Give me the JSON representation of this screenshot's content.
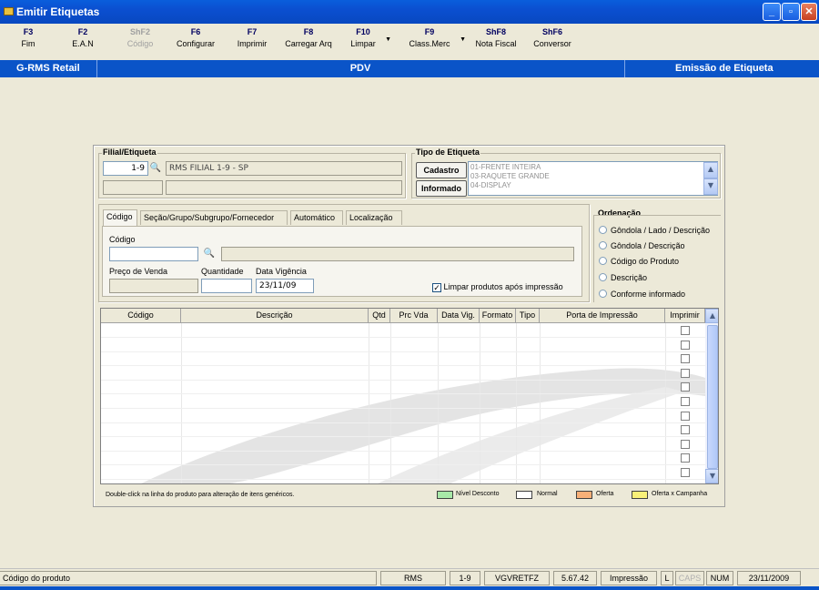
{
  "window": {
    "title": "Emitir Etiquetas"
  },
  "toolbar": [
    {
      "key": "F3",
      "label": "Fim",
      "enabled": true
    },
    {
      "key": "F2",
      "label": "E.A.N",
      "enabled": true
    },
    {
      "key": "ShF2",
      "label": "Código",
      "enabled": false
    },
    {
      "key": "F6",
      "label": "Configurar",
      "enabled": true
    },
    {
      "key": "F7",
      "label": "Imprimir",
      "enabled": true
    },
    {
      "key": "F8",
      "label": "Carregar Arq",
      "enabled": true
    },
    {
      "key": "F10",
      "label": "Limpar",
      "enabled": true
    },
    {
      "key": "F9",
      "label": "Class.Merc",
      "enabled": true
    },
    {
      "key": "ShF8",
      "label": "Nota Fiscal",
      "enabled": true
    },
    {
      "key": "ShF6",
      "label": "Conversor",
      "enabled": true
    }
  ],
  "header": {
    "left": "G-RMS Retail",
    "center": "PDV",
    "right": "Emissão de Etiqueta"
  },
  "filial": {
    "group_label": "Filial/Etiqueta",
    "code": "1-9",
    "name": "RMS FILIAL 1-9 - SP",
    "code2": "",
    "name2": ""
  },
  "tipo": {
    "group_label": "Tipo de Etiqueta",
    "btn_cadastro": "Cadastro",
    "btn_informado": "Informado",
    "options": [
      "01-FRENTE INTEIRA",
      "03-RAQUETE GRANDE",
      "04-DISPLAY"
    ]
  },
  "tabs": [
    "Código",
    "Seção/Grupo/Subgrupo/Fornecedor",
    "Automático",
    "Localização"
  ],
  "form": {
    "codigo_label": "Código",
    "codigo_value": "",
    "descricao_value": "",
    "preco_label": "Preço de Venda",
    "preco_value": "",
    "quantidade_label": "Quantidade",
    "quantidade_value": "",
    "vigencia_label": "Data Vigência",
    "vigencia_value": "23/11/09",
    "limpar_label": "Limpar produtos após impressão",
    "limpar_checked": true
  },
  "ordenacao": {
    "label": "Ordenação",
    "options": [
      "Gôndola / Lado / Descrição",
      "Gôndola / Descrição",
      "Código do Produto",
      "Descrição",
      "Conforme informado"
    ]
  },
  "grid": {
    "columns": [
      "Código",
      "Descrição",
      "Qtd",
      "Prc Vda",
      "Data Vig.",
      "Formato",
      "Tipo",
      "Porta de Impressão",
      "Imprimir"
    ]
  },
  "hint": "Double-click na linha do produto para alteração de itens genéricos.",
  "legend": [
    {
      "label": "Nível Desconto",
      "color": "#A8E8A8"
    },
    {
      "label": "Normal",
      "color": "#FFFFFF"
    },
    {
      "label": "Oferta",
      "color": "#F8B078"
    },
    {
      "label": "Oferta x Campanha",
      "color": "#F8F078"
    }
  ],
  "status": [
    "Código do produto",
    "RMS",
    "1-9",
    "VGVRETFZ",
    "5.67.42",
    "Impressão",
    "L",
    "CAPS",
    "NUM",
    "23/11/2009"
  ]
}
